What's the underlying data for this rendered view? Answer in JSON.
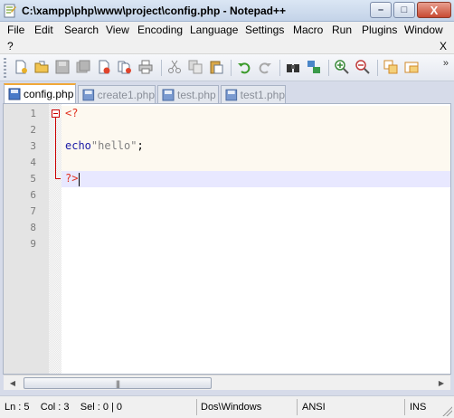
{
  "window": {
    "title": "C:\\xampp\\php\\www\\project\\config.php - Notepad++",
    "minimize_glyph": "–",
    "maximize_glyph": "□",
    "close_glyph": "X"
  },
  "menu": {
    "items": [
      "File",
      "Edit",
      "Search",
      "View",
      "Encoding",
      "Language",
      "Settings",
      "Macro",
      "Run",
      "Plugins",
      "Window"
    ],
    "help": "?",
    "close_doc": "X"
  },
  "toolbar": {
    "overflow": "»",
    "icons": [
      "new-file-icon",
      "open-file-icon",
      "save-icon",
      "save-all-icon",
      "close-icon",
      "close-all-icon",
      "print-icon",
      "cut-icon",
      "copy-icon",
      "paste-icon",
      "undo-icon",
      "redo-icon",
      "find-icon",
      "replace-icon",
      "zoom-in-icon",
      "zoom-out-icon",
      "sync-vertical-icon",
      "sync-horizontal-icon"
    ]
  },
  "tabs": [
    {
      "label": "config.php",
      "active": true
    },
    {
      "label": "create1.php",
      "active": false
    },
    {
      "label": "test.php",
      "active": false
    },
    {
      "label": "test1.php",
      "active": false
    }
  ],
  "editor": {
    "line_numbers": [
      "1",
      "2",
      "3",
      "4",
      "5",
      "6",
      "7",
      "8",
      "9"
    ],
    "line1_tag": "<?",
    "line3_keyword": "echo",
    "line3_string": "\"hello\"",
    "line3_end": ";",
    "line5_tag": "?>"
  },
  "scrollbar": {
    "left_arrow": "◀",
    "right_arrow": "▶",
    "grip": "|||"
  },
  "status": {
    "position": "Ln : 5    Col : 3    Sel : 0 | 0",
    "eol": "Dos\\Windows",
    "encoding": "ANSI",
    "mode": "INS"
  },
  "colors": {
    "php_tag": "#e0301e",
    "keyword": "#1a1aa6",
    "string": "#808080",
    "active_tab_accent": "#f0a838",
    "current_line": "#e8e8ff"
  }
}
